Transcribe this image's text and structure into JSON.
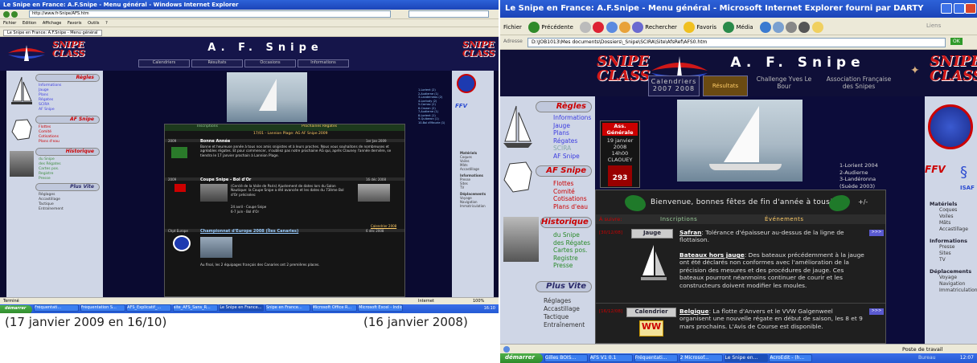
{
  "captions": {
    "left": "(17 janvier 2009 en 16/10)",
    "right": "(16 janvier 2008)"
  },
  "left": {
    "title": "Le Snipe en France: A.F.Snipe - Menu général - Windows Internet Explorer",
    "address": "http://www.fr-Snipe/AFS.htm",
    "menu": [
      "Fichier",
      "Edition",
      "Affichage",
      "Favoris",
      "Outils",
      "?"
    ],
    "tab": "Le Snipe en France: A.F.Snipe - Menu général",
    "site_title": "A. F. Snipe",
    "logo_text": "SNIPE CLASS",
    "nav": [
      "Calendriers",
      "Résultats",
      "Occasions",
      "Informations"
    ],
    "sections": [
      {
        "title": "Règles",
        "links": [
          "Informations",
          "Jauge",
          "Plans",
          "Régates",
          "SCIRA",
          "AF Snipe"
        ]
      },
      {
        "title": "AF Snipe",
        "links": [
          "Flottes",
          "Comité",
          "Cotisations",
          "Plans d'eau"
        ]
      },
      {
        "title": "Historique",
        "links": [
          "du Snipe",
          "des Régates",
          "Cartes pos.",
          "Registre",
          "Presse"
        ]
      },
      {
        "title": "Plus Vite",
        "links": [
          "Réglages",
          "Accastillage",
          "Tactique",
          "Entraînement"
        ]
      }
    ],
    "headers": [
      "Inscriptions",
      "Prochaines Régates"
    ],
    "regatta_line": "17/01 - Lannion Plage: AG AF Snipe 2009",
    "news": [
      {
        "year": "2009",
        "title": "Bonne Année",
        "date": "1er Jan 2009",
        "text": "Bonne et heureuse année à tous nos amis snipistes et à leurs proches. Nous vous souhaitons de nombreuses et agréables régates. Et pour commencer, n'oubliez pas notre prochaine AG qui, après Clauney l'année dernière, se tiendra le 17 janvier prochain à Lannion Plage."
      },
      {
        "year": "2009",
        "title": "Coupe Snipe - Bol d'Or",
        "date": "16 déc 2008",
        "text": "(Cerclé de la Voile de Paris) Ajustement de dates lors du Salon Nautique: la Coupe Snipe a été avancée et les dates du 73ème Bol d'Or précisées:",
        "items": [
          "24 avril - Coupe Snipe",
          "6-7 juin - Bol d'Or"
        ]
      },
      {
        "year": "Chpt Europe",
        "title": "Championnat d'Europe 2008 (Îles Canaries)",
        "date": "6 déc 2008",
        "text": "Au final, les 2 équipages français des Canaries ont 2 premières places.",
        "link": "Calendrier 2008"
      }
    ],
    "right_list": [
      "1-Lorient (2)",
      "2-Audierne (1)",
      "3-Landerneau (2)",
      "4-Loctudy (2)",
      "5-Carnac (2)",
      "6-Crozon (2)",
      "7-Audierne (1)",
      "8-Lorient (1)",
      "9-Quiberon (1)",
      "10-Bol d'Maurie (1)"
    ],
    "right_menu": {
      "mat_title": "Matériels",
      "mat": [
        "Coques",
        "Voiles",
        "Mâts",
        "Accastillage"
      ],
      "info_title": "Informations",
      "info": [
        "Presse",
        "Sites",
        "TV"
      ],
      "dep_title": "Déplacements",
      "dep": [
        "Voyage",
        "Navigation",
        "Immatriculation"
      ]
    },
    "status": "Terminé",
    "status_zone": "Internet",
    "zoom": "100%",
    "taskbar_start": "démarrer",
    "taskbar_items": [
      "Fréquentati...",
      "Fréquentation S...",
      "AFS_Explicatif_...",
      "site_AFS_Sans_R...",
      "Le Snipe en France...",
      "Snipe en France...",
      "Microsoft Office R...",
      "Microsoft Excel - Indic..."
    ],
    "clock": "16:10"
  },
  "right": {
    "title": "Le Snipe en France: A.F.Snipe - Menu général - Microsoft Internet Explorer fourni par DARTY",
    "toolbar": [
      "Fichier",
      "Précédente",
      "Rechercher",
      "Favoris",
      "Média"
    ],
    "address_label": "Adresse",
    "address": "D:\\JOB1013\\Mes documents\\Dossiers\\_Snipe\\SCIRA\\Site\\AfsRef\\AFS0.htm",
    "links_label": "Liens",
    "go_label": "OK",
    "site_title": "A. F. Snipe",
    "logo_text": "SNIPE CLASS",
    "nav_calendriers": "Calendriers",
    "nav_years": "2007   2008",
    "nav_resultats": "Résultats",
    "nav_challenge": "Challenge Yves Le Bour",
    "nav_assoc": "Association Française des Snipes",
    "sections": [
      {
        "title": "Règles",
        "links": [
          "Informations",
          "Jauge",
          "Plans",
          "Régates",
          "SCIRA",
          "AF Snipe"
        ]
      },
      {
        "title": "AF Snipe",
        "links": [
          "Flottes",
          "Comité",
          "Cotisations",
          "Plans d'eau"
        ]
      },
      {
        "title": "Historique",
        "links": [
          "du Snipe",
          "des Régates",
          "Cartes pos.",
          "Registre",
          "Presse"
        ]
      },
      {
        "title": "Plus Vite",
        "links": [
          "Réglages",
          "Accastillage",
          "Tactique",
          "Entraînement"
        ]
      }
    ],
    "ag_label": "Ass. Générale",
    "ag_date": "19 janvier 2008",
    "ag_time": "14h00",
    "ag_place": "CLAOUEY",
    "flotte_num": "293",
    "podium": [
      "1-Lorient 2004",
      "2-Audierne",
      "3-Landéronna",
      "(Suède 2003)"
    ],
    "welcome": "Bienvenue, bonnes fêtes de fin d'année à tous!",
    "plusminus": "+/-",
    "a_suivre": "À suivre:",
    "col_inscriptions": "Inscriptions",
    "col_evenements": "Événements",
    "news": [
      {
        "date": "[30/12/08]",
        "tag": "Jauge",
        "title": "Safran",
        "text": ": Tolérance d'épaisseur au-dessus de la ligne de flottaison."
      },
      {
        "date": "",
        "tag": "",
        "title": "Bateaux hors jauge",
        "text": ": Des bateaux précédemment à la jauge ont été déclarés non conformes avec l'amélioration de la précision des mesures et des procédures de jauge. Ces bateaux pourront néanmoins continuer de courir et les constructeurs doivent modifier les moules."
      },
      {
        "date": "[16/12/08]",
        "tag": "Calendrier",
        "title": "Belgique",
        "text": ": La flotte d'Anvers et le VVW Galgenweel organisent une nouvelle régate en début de saison, les 8 et 9 mars prochains. L'Avis de Course est disponible."
      }
    ],
    "mat_title": "Matériels",
    "mat": [
      "Coques",
      "Voiles",
      "Mâts",
      "Accastillage"
    ],
    "info_title": "Informations",
    "info": [
      "Presse",
      "Sites",
      "TV"
    ],
    "dep_title": "Déplacements",
    "dep": [
      "Voyage",
      "Navigation",
      "Immatriculation"
    ],
    "isaf": "ISAF",
    "status": "Poste de travail",
    "taskbar_start": "démarrer",
    "taskbar_items": [
      "Gilles BOIS...",
      "AFS V1 0.1",
      "Fréquentati...",
      "2 Microsof...",
      "Le Snipe en...",
      "AcroEdit - (h..."
    ],
    "taskbar_desk": "Bureau",
    "clock": "12:07"
  }
}
